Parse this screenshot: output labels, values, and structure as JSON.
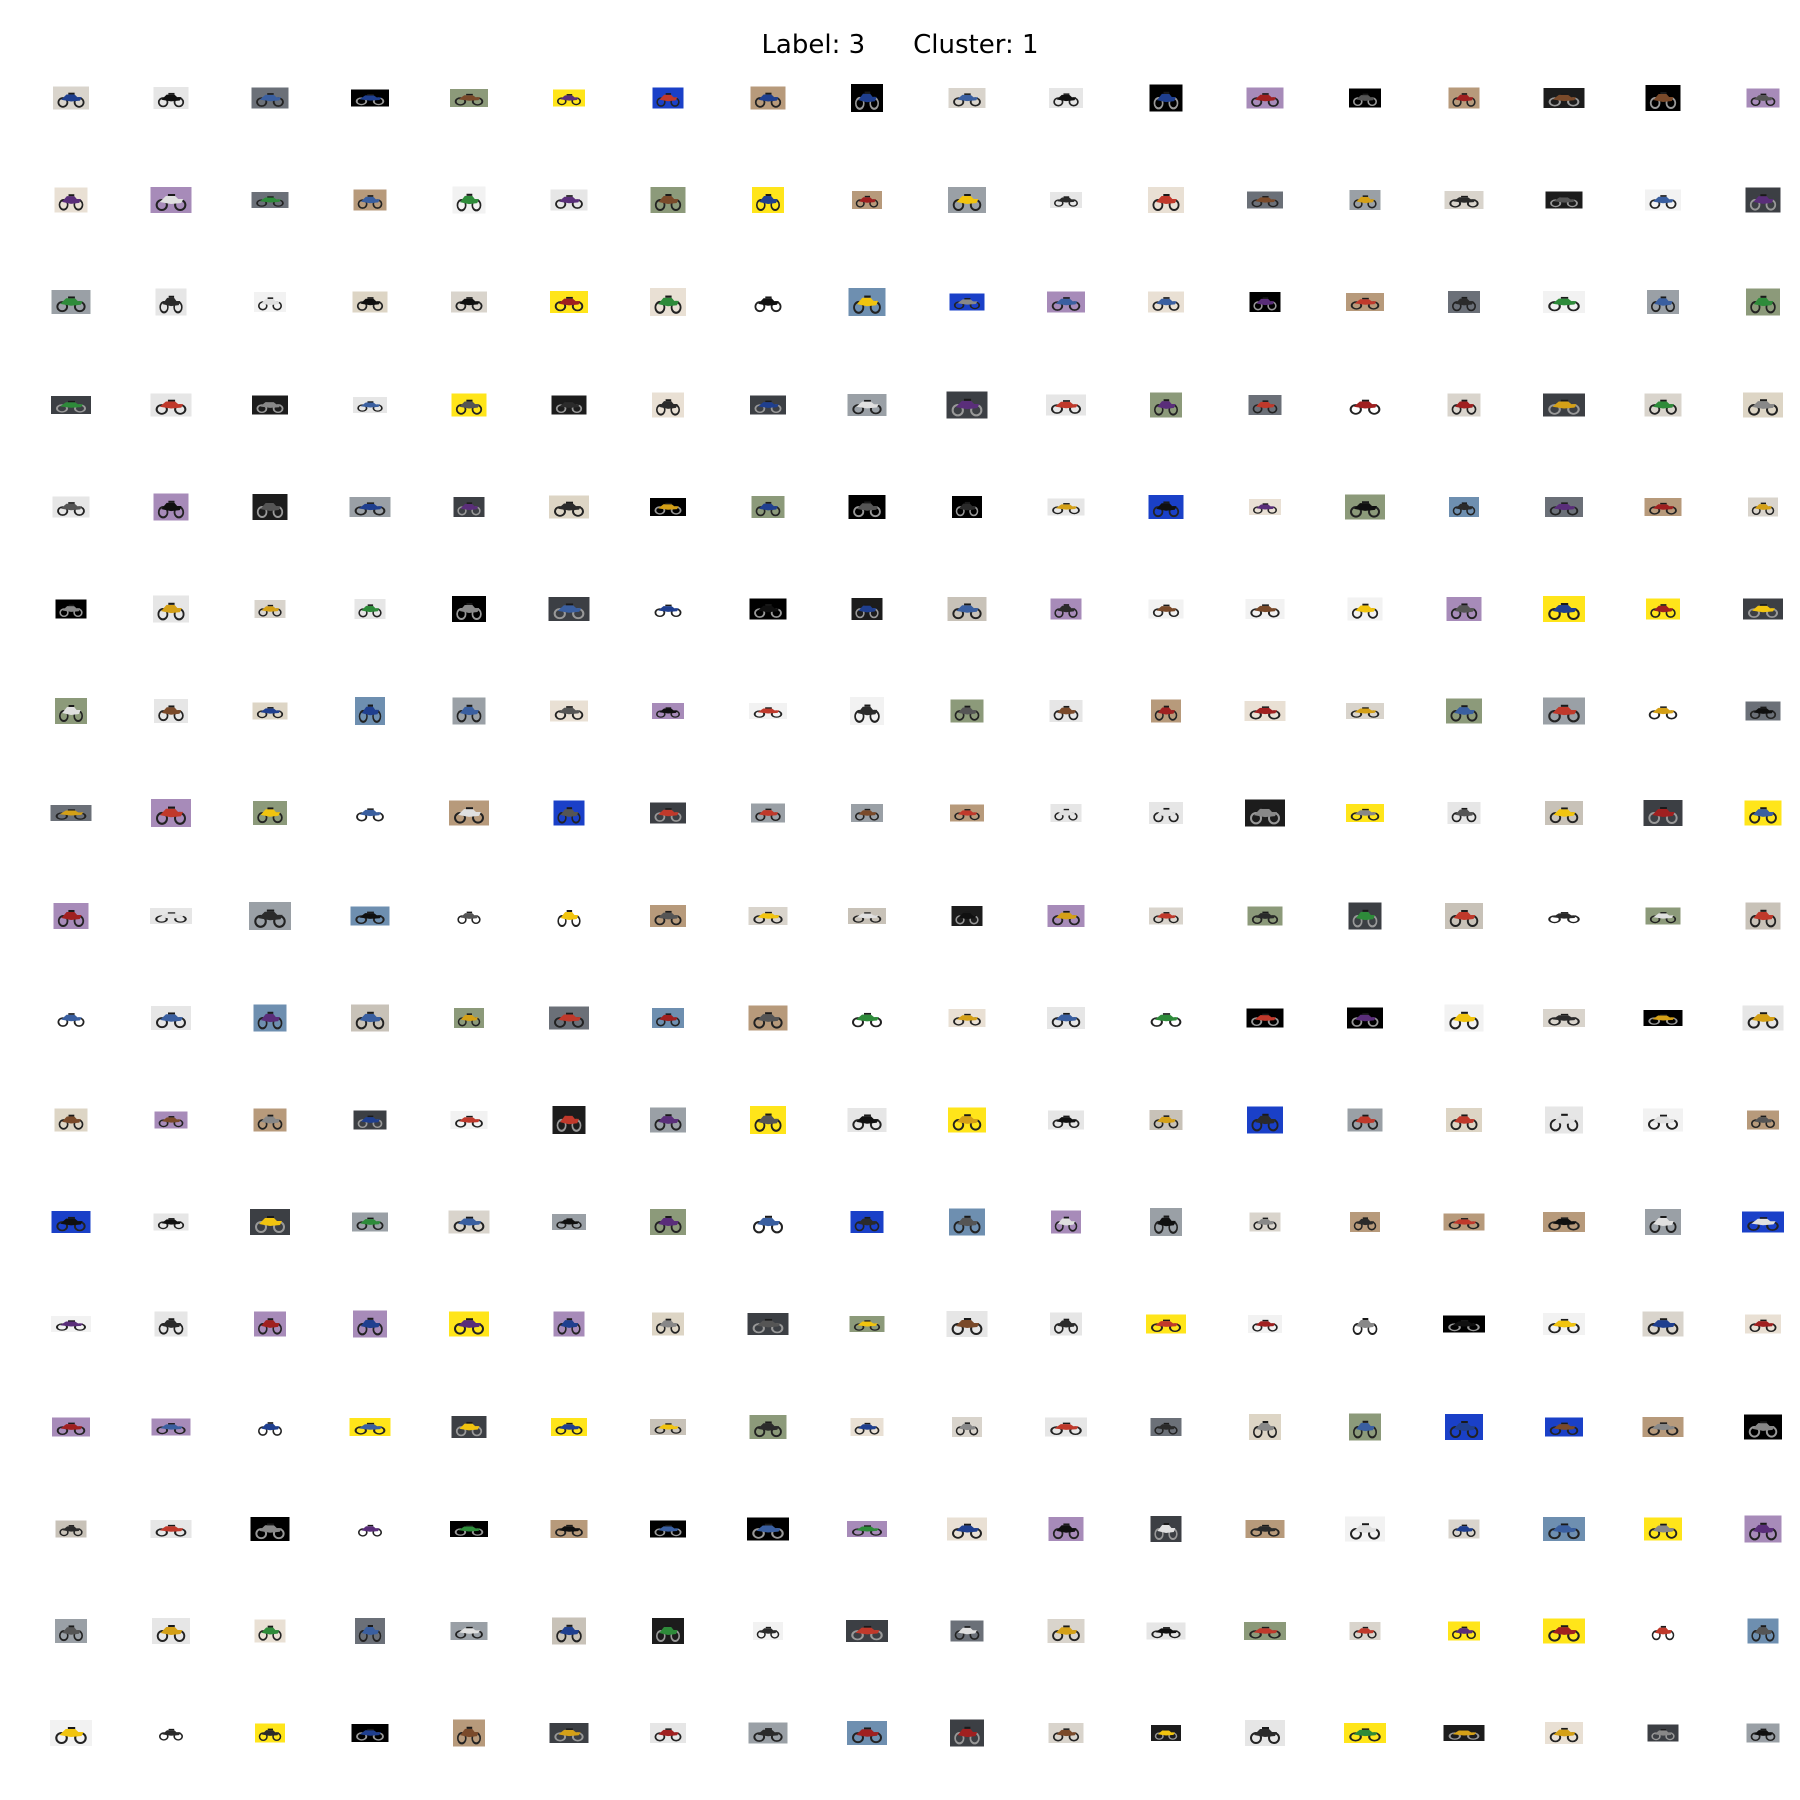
{
  "header": {
    "label_text": "Label: 3",
    "cluster_text": "Cluster: 1"
  },
  "grid": {
    "rows": 17,
    "cols": 18,
    "content": "motorcycle photo thumbnails"
  },
  "palette": {
    "photo_backgrounds": [
      "#f2f2f2",
      "#e6e6e6",
      "#d9d4cc",
      "#c8c2b8",
      "#9aa0a6",
      "#6b7078",
      "#3c3f44",
      "#1c1c1c",
      "#000000",
      "#ddd5c5",
      "#8c9a7a",
      "#6e8fb0",
      "#b79a7b",
      "#a78bb9",
      "#ffffff",
      "#e9e0d4",
      "#ffe51a",
      "#1a40c8"
    ],
    "bike_colors": [
      "#2b2b2b",
      "#555555",
      "#c0392b",
      "#1f3f8f",
      "#d4a017",
      "#2e8b3a",
      "#7a4a2a",
      "#888888",
      "#e0e0e0",
      "#a02020",
      "#3a5fa0",
      "#f1c40f",
      "#101010",
      "#5a2e7a"
    ]
  }
}
